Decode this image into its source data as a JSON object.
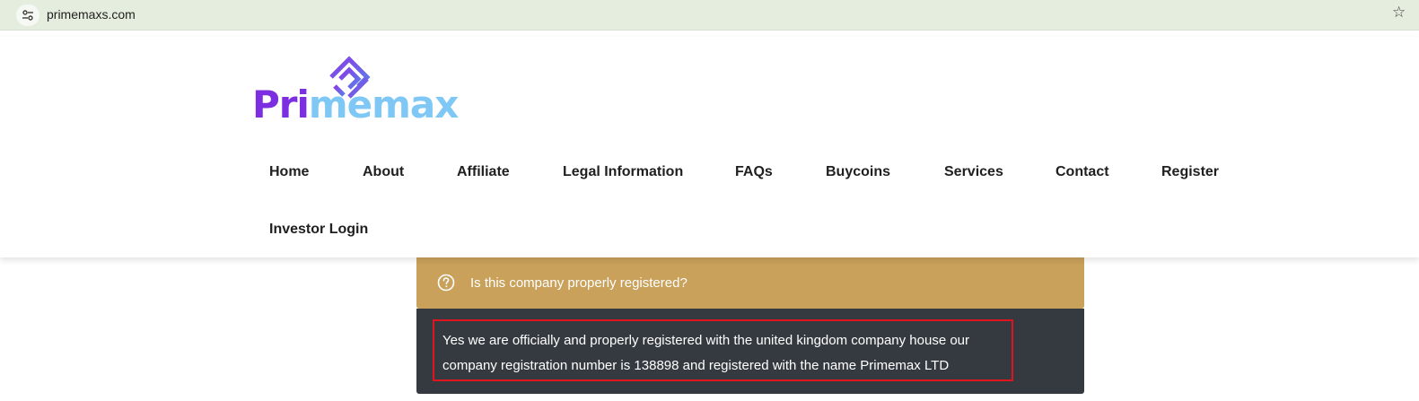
{
  "browser": {
    "url": "primemaxs.com",
    "site_info_icon": "tune-icon",
    "bookmark_icon": "star-icon"
  },
  "logo": {
    "text_part1": "Pri",
    "text_part2": "memax",
    "colors": {
      "purple": "#7b2fe0",
      "light_blue": "#7fc8f5"
    }
  },
  "nav": {
    "items": [
      {
        "label": "Home"
      },
      {
        "label": "About"
      },
      {
        "label": "Affiliate"
      },
      {
        "label": "Legal Information"
      },
      {
        "label": "FAQs"
      },
      {
        "label": "Buycoins"
      },
      {
        "label": "Services"
      },
      {
        "label": "Contact"
      },
      {
        "label": "Register"
      },
      {
        "label": "Investor Login"
      }
    ]
  },
  "faq": {
    "question": "Is this company properly registered?",
    "question_icon": "question-circle-icon",
    "answer": "Yes we are officially and properly registered with the united kingdom company house our company registration number is 138898 and registered with the name Primemax LTD",
    "colors": {
      "header_bg": "#c9a15a",
      "body_bg": "#343a40",
      "highlight_border": "#e0141e"
    }
  }
}
